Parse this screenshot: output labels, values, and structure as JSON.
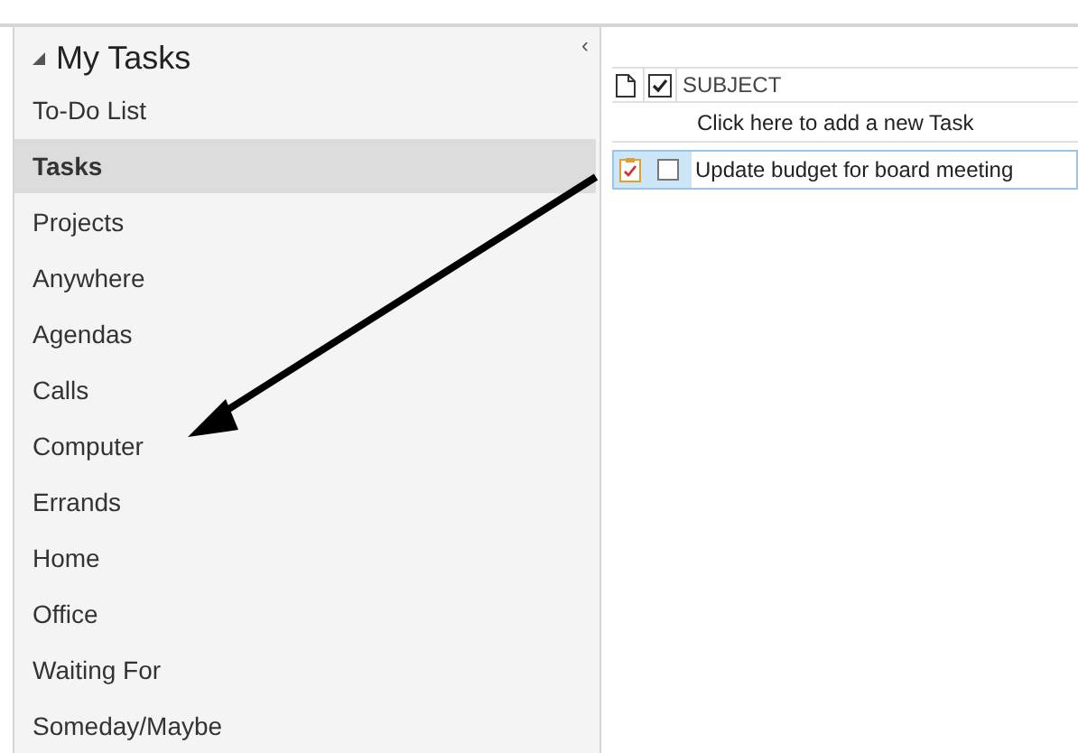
{
  "sidebar": {
    "collapse_glyph": "‹",
    "group": {
      "title": "My Tasks",
      "expanded": true
    },
    "items": [
      {
        "label": "To-Do List",
        "selected": false
      },
      {
        "label": "Tasks",
        "selected": true
      },
      {
        "label": "Projects",
        "selected": false
      },
      {
        "label": "Anywhere",
        "selected": false
      },
      {
        "label": "Agendas",
        "selected": false
      },
      {
        "label": "Calls",
        "selected": false
      },
      {
        "label": "Computer",
        "selected": false
      },
      {
        "label": "Errands",
        "selected": false
      },
      {
        "label": "Home",
        "selected": false
      },
      {
        "label": "Office",
        "selected": false
      },
      {
        "label": "Waiting For",
        "selected": false
      },
      {
        "label": "Someday/Maybe",
        "selected": false
      }
    ]
  },
  "task_list": {
    "column": "SUBJECT",
    "new_task_prompt": "Click here to add a new Task",
    "rows": [
      {
        "subject": "Update budget for board meeting",
        "complete": false,
        "selected": true
      }
    ]
  }
}
